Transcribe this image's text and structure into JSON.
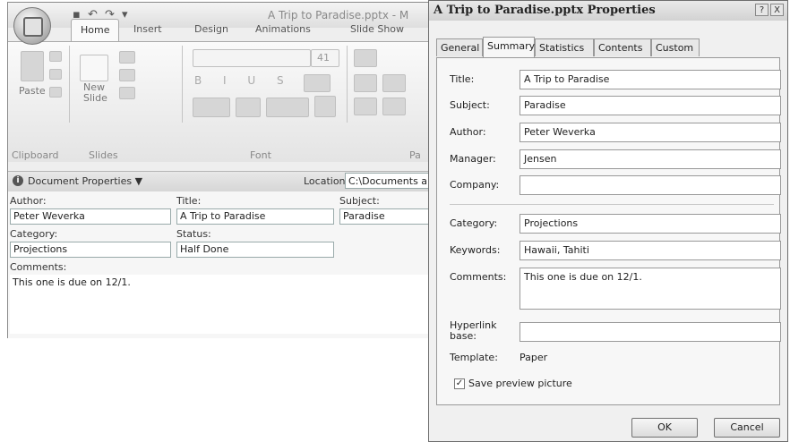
{
  "powerpoint": {
    "window_title": "A Trip to Paradise.pptx - M",
    "tabs": [
      "Home",
      "Insert",
      "Design",
      "Animations",
      "Slide Show"
    ],
    "ribbon": {
      "paste": "Paste",
      "new_slide_line1": "New",
      "new_slide_line2": "Slide",
      "font_size": "41",
      "groups": [
        "Clipboard",
        "Slides",
        "Font",
        "Pa"
      ]
    },
    "doc_props_bar": {
      "title": "Document Properties",
      "location_label": "Location:",
      "location_value": "C:\\Documents a"
    },
    "doc_panel": {
      "author_label": "Author:",
      "author_value": "Peter Weverka",
      "title_label": "Title:",
      "title_value": "A Trip to Paradise",
      "subject_label": "Subject:",
      "subject_value": "Paradise",
      "category_label": "Category:",
      "category_value": "Projections",
      "status_label": "Status:",
      "status_value": "Half Done",
      "comments_label": "Comments:",
      "comments_value": "This one is due on 12/1."
    }
  },
  "dialog": {
    "title": "A Trip to Paradise.pptx Properties",
    "help_btn": "?",
    "close_btn": "X",
    "tabs": [
      "General",
      "Summary",
      "Statistics",
      "Contents",
      "Custom"
    ],
    "active_tab": "Summary",
    "fields": {
      "title": {
        "label": "Title:",
        "value": "A Trip to Paradise"
      },
      "subject": {
        "label": "Subject:",
        "value": "Paradise"
      },
      "author": {
        "label": "Author:",
        "value": "Peter Weverka"
      },
      "manager": {
        "label": "Manager:",
        "value": "Jensen"
      },
      "company": {
        "label": "Company:",
        "value": ""
      },
      "category": {
        "label": "Category:",
        "value": "Projections"
      },
      "keywords": {
        "label": "Keywords:",
        "value": "Hawaii, Tahiti"
      },
      "comments": {
        "label": "Comments:",
        "value": "This one is due on 12/1."
      },
      "hyperlink_base": {
        "label_line1": "Hyperlink",
        "label_line2": "base:",
        "value": ""
      }
    },
    "template_label": "Template:",
    "template_value": "Paper",
    "save_preview": {
      "label": "Save preview picture",
      "checked": true
    },
    "ok": "OK",
    "cancel": "Cancel"
  }
}
